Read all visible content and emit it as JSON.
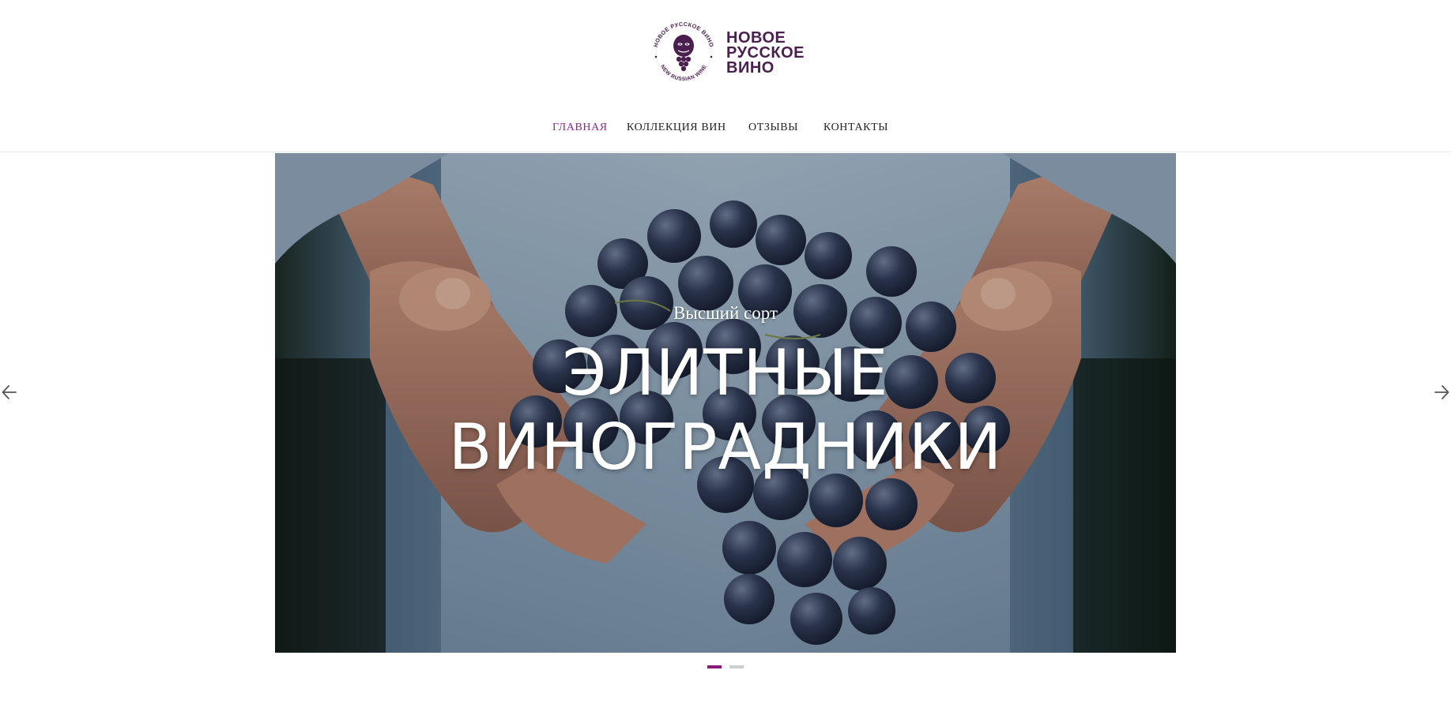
{
  "brand": {
    "seal_text_top": "НОВОЕ РУССКОЕ ВИНО",
    "seal_text_bottom": "NEW RUSSIAN WINE",
    "name_line1": "НОВОЕ",
    "name_line2": "РУССКОЕ",
    "name_line3": "ВИНО",
    "color": "#4a1f4f"
  },
  "nav": {
    "items": [
      {
        "label": "ГЛАВНАЯ",
        "active": true
      },
      {
        "label": "КОЛЛЕКЦИЯ ВИН",
        "active": false
      },
      {
        "label": "ОТЗЫВЫ",
        "active": false
      },
      {
        "label": "КОНТАКТЫ",
        "active": false
      }
    ],
    "active_color": "#8a2b8c"
  },
  "slider": {
    "subtitle": "Высший сорт",
    "title_line1": "ЭЛИТНЫЕ",
    "title_line2": "ВИНОГРАДНИКИ",
    "image": "hands-holding-grapes",
    "prev_icon": "arrow-left-icon",
    "next_icon": "arrow-right-icon",
    "slide_count": 2,
    "active_slide": 1,
    "dot_active_color": "#8a1a78"
  }
}
